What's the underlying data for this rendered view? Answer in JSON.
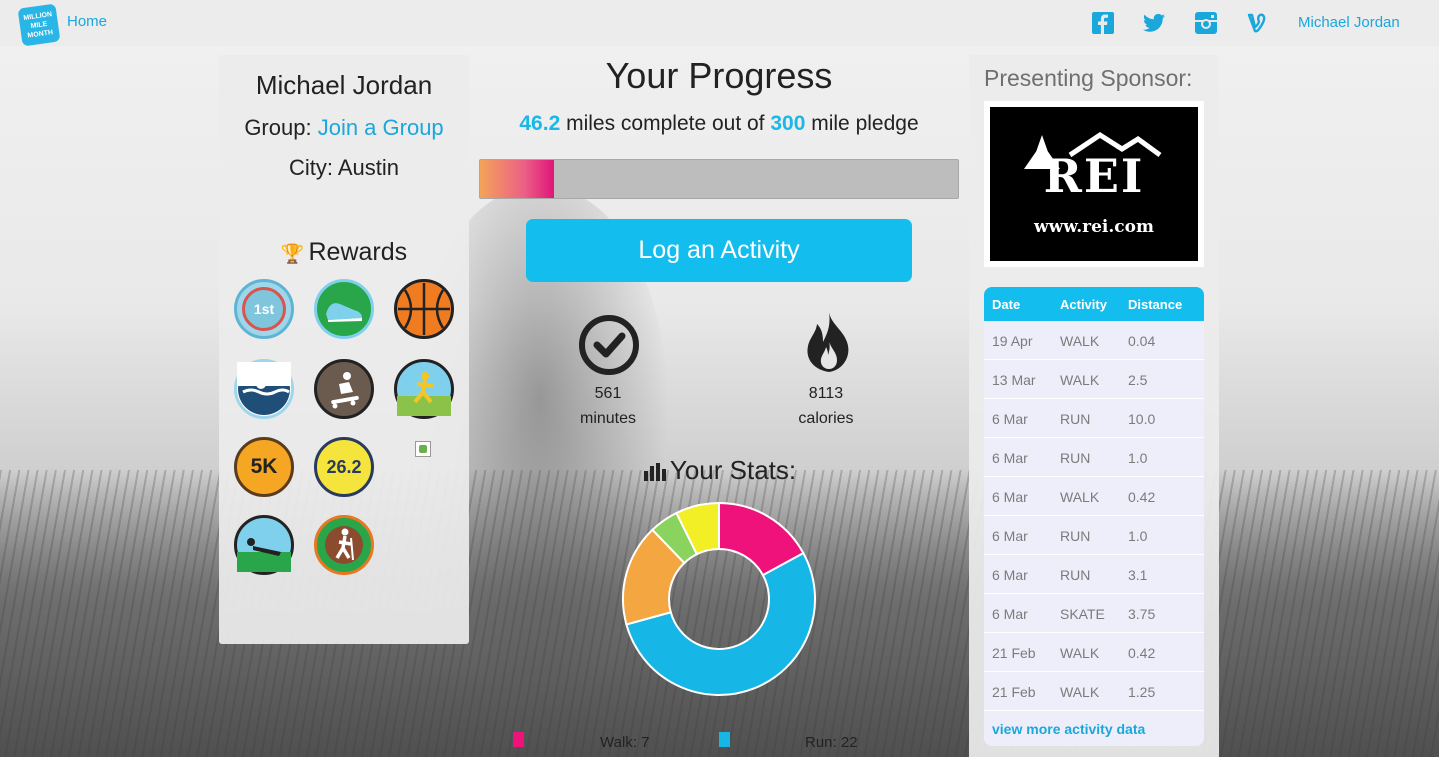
{
  "nav": {
    "logo_text": "MILLION MILE MONTH",
    "home": "Home",
    "user": "Michael Jordan",
    "social": [
      "facebook-icon",
      "twitter-icon",
      "instagram-icon",
      "vine-icon"
    ]
  },
  "profile": {
    "name": "Michael Jordan",
    "group_label": "Group:",
    "group_link": "Join a Group",
    "city": "City: Austin",
    "rewards_title": "Rewards",
    "badges": [
      {
        "name": "first-badge-icon",
        "label": "1st"
      },
      {
        "name": "shoe-badge-icon",
        "label": ""
      },
      {
        "name": "basketball-badge-icon",
        "label": ""
      },
      {
        "name": "swim-badge-icon",
        "label": ""
      },
      {
        "name": "skateboard-badge-icon",
        "label": ""
      },
      {
        "name": "runner-beach-badge-icon",
        "label": ""
      },
      {
        "name": "5k-badge-icon",
        "label": "5K"
      },
      {
        "name": "marathon-badge-icon",
        "label": "26.2"
      },
      {
        "name": "broken-image-icon",
        "label": ""
      },
      {
        "name": "swimmer-badge-icon",
        "label": ""
      },
      {
        "name": "hiker-badge-icon",
        "label": ""
      }
    ]
  },
  "progress": {
    "title": "Your Progress",
    "miles_done": "46.2",
    "mid_text": " miles complete out of ",
    "pledge": "300",
    "end_text": " mile pledge",
    "fraction": 0.154
  },
  "log_button": "Log an Activity",
  "stats": {
    "minutes_value": "561",
    "minutes_label": "minutes",
    "calories_value": "8113",
    "calories_label": "calories",
    "title": "Your Stats:"
  },
  "chart_data": {
    "type": "pie",
    "donut": true,
    "slices": [
      {
        "label": "Walk",
        "value": 7,
        "color": "#f0127b"
      },
      {
        "label": "Run",
        "value": 22,
        "color": "#16b6e6"
      },
      {
        "label": "",
        "value": 7,
        "color": "#f4a640"
      },
      {
        "label": "",
        "value": 2,
        "color": "#8bd35f"
      },
      {
        "label": "",
        "value": 3,
        "color": "#f3ef27"
      }
    ],
    "legend": [
      {
        "text": "Walk: 7",
        "color": "#f0127b"
      },
      {
        "text": "Run: 22",
        "color": "#16b6e6"
      }
    ]
  },
  "sponsor": {
    "title": "Presenting Sponsor:",
    "logo_text": "REI",
    "logo_url": "www.rei.com"
  },
  "activity": {
    "headers": [
      "Date",
      "Activity",
      "Distance"
    ],
    "rows": [
      [
        "19 Apr",
        "WALK",
        "0.04"
      ],
      [
        "13 Mar",
        "WALK",
        "2.5"
      ],
      [
        "6 Mar",
        "RUN",
        "10.0"
      ],
      [
        "6 Mar",
        "RUN",
        "1.0"
      ],
      [
        "6 Mar",
        "WALK",
        "0.42"
      ],
      [
        "6 Mar",
        "RUN",
        "1.0"
      ],
      [
        "6 Mar",
        "RUN",
        "3.1"
      ],
      [
        "6 Mar",
        "SKATE",
        "3.75"
      ],
      [
        "21 Feb",
        "WALK",
        "0.42"
      ],
      [
        "21 Feb",
        "WALK",
        "1.25"
      ]
    ],
    "more": "view more activity data"
  }
}
